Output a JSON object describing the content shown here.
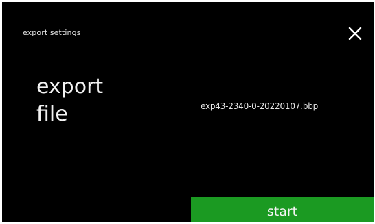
{
  "header": {
    "title": "export settings",
    "close_icon": "close-icon"
  },
  "main": {
    "label_line1": "export",
    "label_line2": "file",
    "file_name": "exp43-2340-0-20220107.bbp"
  },
  "footer": {
    "start_label": "start"
  },
  "colors": {
    "background": "#000000",
    "accent": "#1b9a22",
    "text": "#f2f2f2"
  }
}
